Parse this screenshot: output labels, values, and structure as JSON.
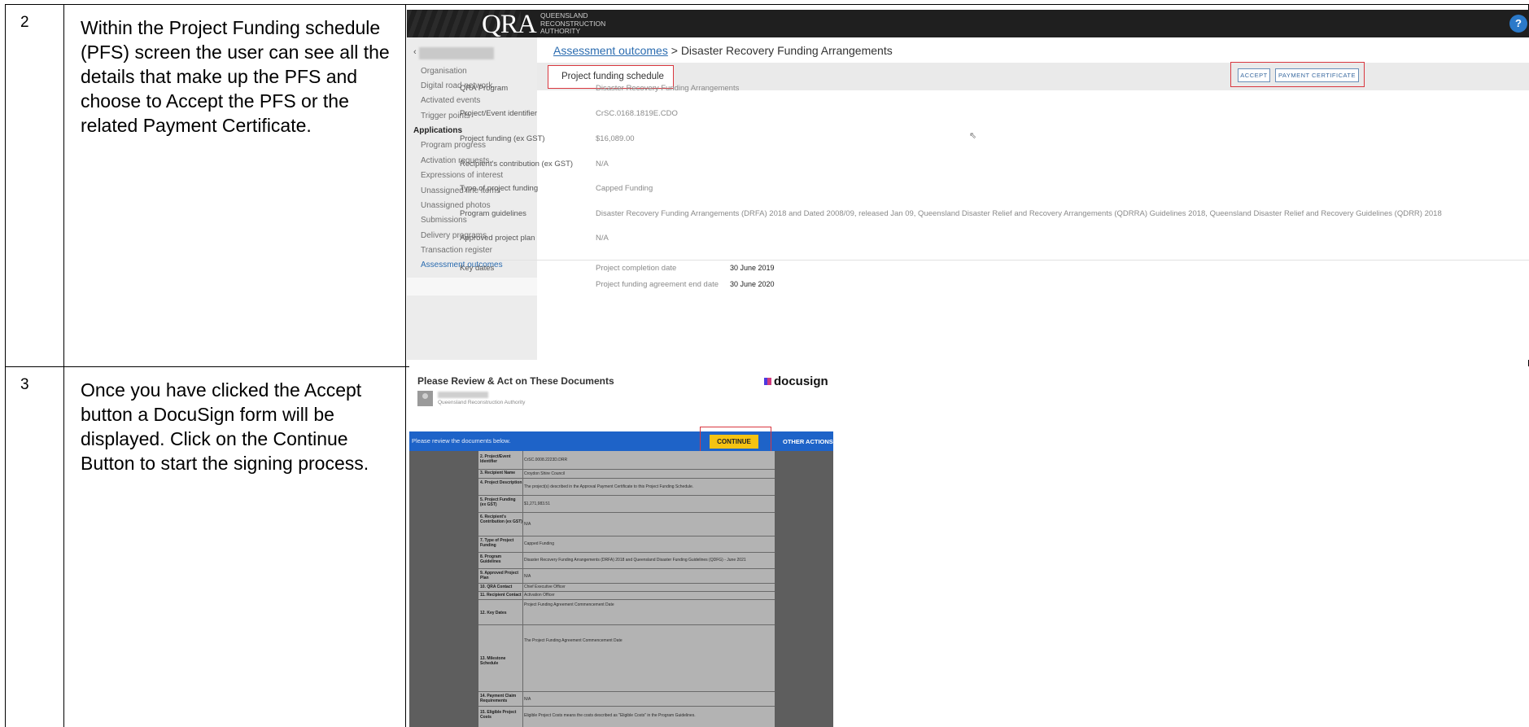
{
  "rows": [
    {
      "number": "2",
      "description": "Within the Project Funding schedule (PFS) screen the user can see all the details that make up the PFS and choose to Accept the PFS or the related Payment Certificate."
    },
    {
      "number": "3",
      "description": "Once you have clicked the Accept button a DocuSign form will be displayed.  Click on the Continue Button to start the signing process."
    }
  ],
  "qra": {
    "logo": "QRA",
    "logo_sub": [
      "QUEENSLAND",
      "RECONSTRUCTION",
      "AUTHORITY"
    ],
    "help": "?",
    "sidebar": {
      "items_top": [
        "Organisation",
        "Digital road network",
        "Activated events",
        "Trigger points"
      ],
      "section": "Applications",
      "items": [
        "Program progress",
        "Activation requests",
        "Expressions of interest",
        "Unassigned line items",
        "Unassigned photos",
        "Submissions",
        "Delivery programs",
        "Transaction register",
        "Assessment outcomes"
      ]
    },
    "breadcrumb": {
      "link": "Assessment outcomes",
      "separator": ">",
      "current": "Disaster Recovery Funding Arrangements"
    },
    "tab": "Project funding schedule",
    "buttons": {
      "accept": "ACCEPT",
      "payment_certificate": "PAYMENT CERTIFICATE"
    },
    "fields": [
      {
        "label": "QRA Program",
        "value": "Disaster Recovery Funding Arrangements"
      },
      {
        "label": "Project/Event identifier",
        "value": "CrSC.0168.1819E.CDO"
      },
      {
        "label": "Project funding (ex GST)",
        "value": "$16,089.00"
      },
      {
        "label": "Recipient's contribution (ex GST)",
        "value": "N/A"
      },
      {
        "label": "Type of project funding",
        "value": "Capped Funding"
      },
      {
        "label": "Program guidelines",
        "value": "Disaster Recovery Funding Arrangements (DRFA) 2018 and Dated 2008/09, released Jan 09, Queensland Disaster Relief and Recovery Arrangements (QDRRA) Guidelines 2018, Queensland Disaster Relief and Recovery Guidelines (QDRR) 2018"
      },
      {
        "label": "Approved project plan",
        "value": "N/A"
      }
    ],
    "key_dates": {
      "label": "Key dates",
      "items": [
        {
          "label": "Project completion date",
          "value": "30 June 2019"
        },
        {
          "label": "Project funding agreement end date",
          "value": "30 June 2020"
        }
      ]
    }
  },
  "docusign": {
    "title": "Please Review & Act on These Documents",
    "logo": "docusign",
    "org": "Queensland Reconstruction Authority",
    "bar_text": "Please review the documents below.",
    "continue": "CONTINUE",
    "other_actions": "OTHER ACTIONS ▾",
    "doc_rows": [
      {
        "label": "2. Project/Event Identifier",
        "value": "CrSC.0008.2223D.DRR"
      },
      {
        "label": "3. Recipient Name",
        "value": "Croydon Shire Council"
      },
      {
        "label": "4. Project Description",
        "value": "The project(s) described in the Approval Payment Certificate to this Project Funding Schedule."
      },
      {
        "label": "5. Project Funding (ex GST)",
        "value": "$1,271,983.51"
      },
      {
        "label": "6. Recipient's Contribution (ex GST)",
        "value": "N/A"
      },
      {
        "label": "7. Type of Project Funding",
        "value": "Capped Funding"
      },
      {
        "label": "8. Program Guidelines",
        "value": "Disaster Recovery Funding Arrangements (DRFA) 2018 and Queensland Disaster Funding Guidelines (QDFG) - June 2021"
      },
      {
        "label": "9. Approved Project Plan",
        "value": "N/A"
      },
      {
        "label": "10. QRA Contact",
        "value": "Chief Executive Officer"
      },
      {
        "label": "11. Recipient Contact",
        "value": "Activation Officer"
      },
      {
        "label": "12. Key Dates",
        "value": "Project Funding Agreement Commencement Date"
      },
      {
        "label": "13. Milestone Schedule",
        "value": "The Project Funding Agreement Commencement Date"
      },
      {
        "label": "14. Payment Claim Requirements",
        "value": "N/A"
      },
      {
        "label": "15. Eligible Project Costs",
        "value": "Eligible Project Costs means the costs described as \"Eligible Costs\" in the Program Guidelines."
      }
    ]
  }
}
